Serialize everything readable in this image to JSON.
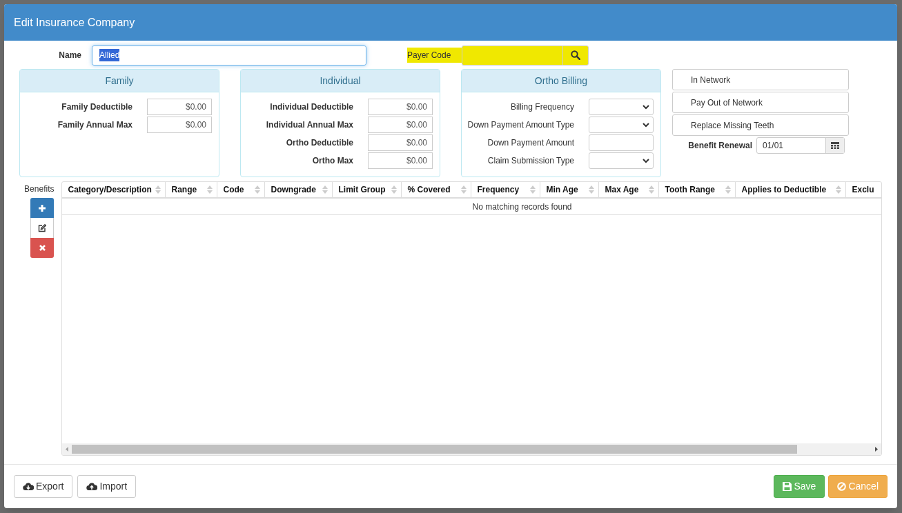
{
  "dialog": {
    "title": "Edit Insurance Company"
  },
  "name_field": {
    "label": "Name",
    "value": "Allied",
    "text_selected": true
  },
  "payer_code": {
    "label": "Payer Code",
    "highlighted": true
  },
  "panels": [
    {
      "title": "Family",
      "fields": [
        {
          "label": "Family Deductible",
          "kind": "money",
          "value": "$0.00"
        },
        {
          "label": "Family Annual Max",
          "kind": "money",
          "value": "$0.00"
        }
      ]
    },
    {
      "title": "Individual",
      "fields": [
        {
          "label": "Individual Deductible",
          "kind": "money",
          "value": "$0.00"
        },
        {
          "label": "Individual Annual Max",
          "kind": "money",
          "value": "$0.00"
        },
        {
          "label": "Ortho Deductible",
          "kind": "money",
          "value": "$0.00"
        },
        {
          "label": "Ortho Max",
          "kind": "money",
          "value": "$0.00"
        }
      ]
    },
    {
      "title": "Ortho Billing",
      "fields": [
        {
          "label": "Billing Frequency",
          "kind": "select"
        },
        {
          "label": "Down Payment Amount Type",
          "kind": "select"
        },
        {
          "label": "Down Payment Amount",
          "kind": "text"
        },
        {
          "label": "Claim Submission Type",
          "kind": "select"
        }
      ]
    }
  ],
  "options": [
    "In Network",
    "Pay Out of Network",
    "Replace Missing Teeth"
  ],
  "benefit_renewal": {
    "label": "Benefit Renewal",
    "value": "01/01"
  },
  "benefits": {
    "label": "Benefits",
    "actions": [
      {
        "kind": "add"
      },
      {
        "kind": "edit"
      },
      {
        "kind": "delete"
      }
    ],
    "columns": [
      "Category/Description",
      "Range",
      "Code",
      "Downgrade",
      "Limit Group",
      "% Covered",
      "Frequency",
      "Min Age",
      "Max Age",
      "Tooth Range",
      "Applies to Deductible",
      "Exclu"
    ],
    "empty_message": "No matching records found"
  },
  "footer_left": [
    {
      "label": "Export",
      "kind": "export"
    },
    {
      "label": "Import",
      "kind": "import"
    }
  ],
  "footer_right": [
    {
      "label": "Save",
      "kind": "save"
    },
    {
      "label": "Cancel",
      "kind": "cancel"
    }
  ]
}
